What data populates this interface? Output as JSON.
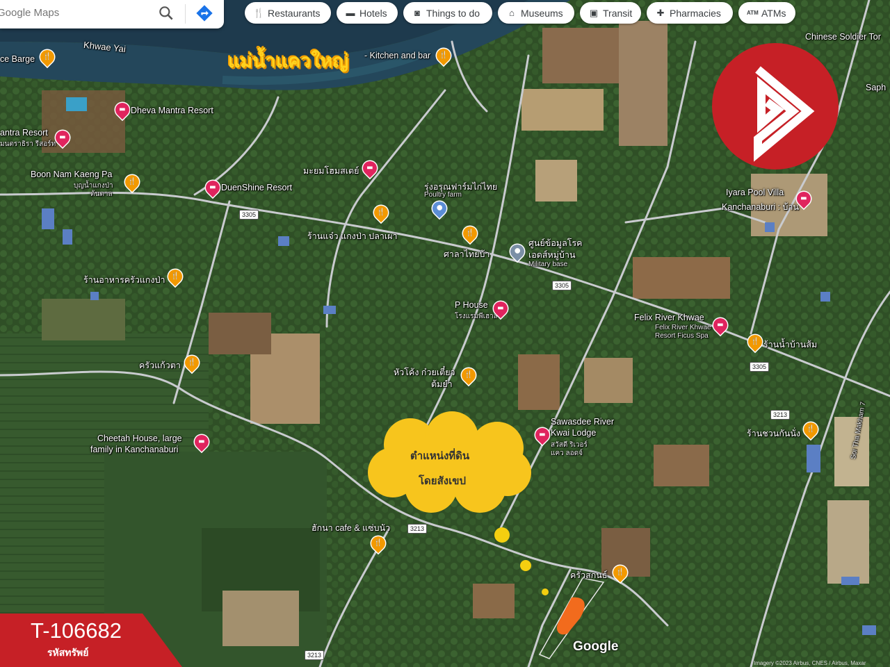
{
  "search": {
    "placeholder": "Google Maps"
  },
  "chips": [
    {
      "label": "Restaurants",
      "icon": "fork-knife-icon"
    },
    {
      "label": "Hotels",
      "icon": "bed-icon"
    },
    {
      "label": "Things to do",
      "icon": "camera-icon"
    },
    {
      "label": "Museums",
      "icon": "museum-icon"
    },
    {
      "label": "Transit",
      "icon": "bus-icon"
    },
    {
      "label": "Pharmacies",
      "icon": "pharmacy-icon"
    },
    {
      "label": "ATMs",
      "icon": "atm-icon"
    }
  ],
  "river": {
    "name": "Khwae Yai",
    "thai_title": "แม่น้ำแควใหญ่"
  },
  "places": {
    "barge": "ce Barge",
    "kitchen": "- Kitchen and bar",
    "dheva": "Dheva Mantra Resort",
    "mantra": "antra Resort",
    "mantra_sub": "มนตราธิรา รีสอร์ท",
    "boon": "Boon Nam Kaeng Pa",
    "boon_sub": "บุญน้ำแกงป่า",
    "boon_sub2": "ต้นตาล",
    "duenshine": "DuenShine Resort",
    "maiyom": "มะยมโฮมสเตย์",
    "poultry": "รุ่งอรุณฟาร์มไก่ไทย",
    "poultry_sub": "Poultry farm",
    "chinese": "Chinese Soldier Tor",
    "saphan": "Saph",
    "iyara": "Iyara Pool Villa",
    "iyara_sub": "Kanchanaburi : บ้าน",
    "raneaw": "ร้านแจ๋ว แกงป่า ปลาเผา",
    "salataima": "ศาลาไทยบ้า",
    "center": "ศูนย์ข้อมูลโรค",
    "center2": "เอดส์หมู่บ้าน",
    "military": "Military base",
    "restaurant_krua": "ร้านอาหารครัวแกงป่า",
    "phouse": "P House",
    "phouse_sub": "โรงแรมพีเฮาส์",
    "felix": "Felix River Khwae",
    "felix_sub": "Felix River Khwae",
    "felix_sub2": "Resort Ficus Spa",
    "ban_som": "ร้านน้ำบ้านส้ม",
    "kuay": "หัวโค้ง ก๋วยเตี๋ยว",
    "kuay2": "ต้มยำ",
    "krua_kaew": "ครัวแก้วตา",
    "sawasdee": "Sawasdee River",
    "sawasdee2": "Kwai Lodge",
    "sawasdee3": "สวัสดี ริเวอร์",
    "sawasdee4": "แคว ลอดจ์",
    "cheetah": "Cheetah House, large",
    "cheetah2": "family in Kanchanaburi",
    "ran_chuan": "ร้านชวนกันนั่ง",
    "soi": "Soi Tha Makham 7",
    "hakna": "ฮักนา cafe & แซ่บนัว",
    "krua_sakon": "ครัวสกนธ์"
  },
  "roads": {
    "r3305": "3305",
    "r3213": "3213"
  },
  "cloud": {
    "line1": "ตำแหน่งที่ดิน",
    "line2": "โดยสังเขป"
  },
  "brand": {
    "logo": "B-logo-icon",
    "color": "#c62026"
  },
  "reference": {
    "code": "T-106682",
    "caption": "รหัสทรัพย์"
  },
  "attribution": {
    "google": "Google",
    "imagery": "Imagery ©2023 Airbus, CNES / Airbus, Maxar"
  }
}
